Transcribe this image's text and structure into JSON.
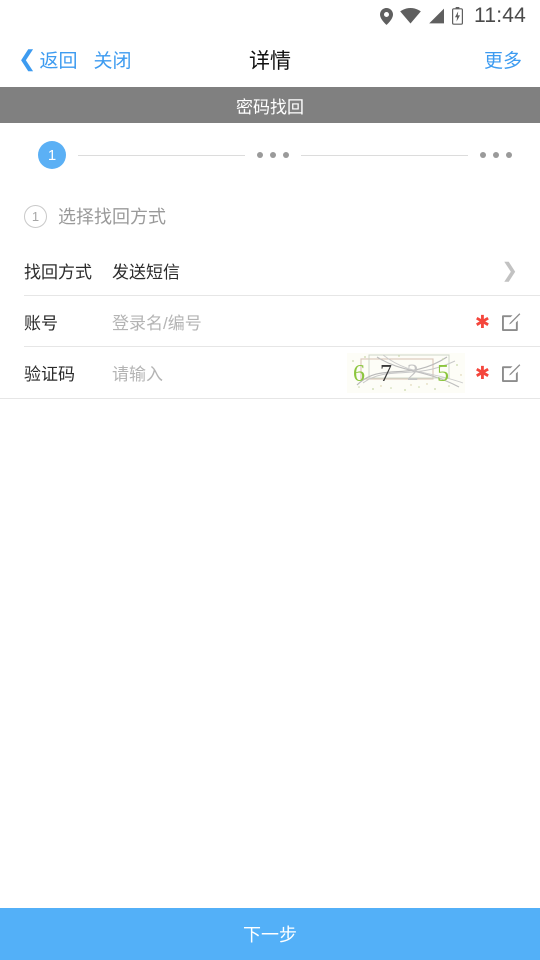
{
  "statusbar": {
    "time": "11:44",
    "icons": [
      "location-pin-icon",
      "wifi-icon",
      "cellular-signal-icon",
      "battery-icon"
    ]
  },
  "navbar": {
    "back_label": "返回",
    "close_label": "关闭",
    "title": "详情",
    "more_label": "更多"
  },
  "subheader": {
    "title": "密码找回"
  },
  "stepper": {
    "current_step": "1",
    "steps_total_indicator": "...",
    "dots": "•••",
    "active_color": "#5bb0f5",
    "line_color": "#dcdcdc"
  },
  "section": {
    "number": "1",
    "label": "选择找回方式"
  },
  "form": {
    "rows": [
      {
        "label": "找回方式",
        "value": "发送短信",
        "accessory": "chevron-right-icon",
        "required": false
      },
      {
        "label": "账号",
        "placeholder": "登录名/编号",
        "value": "",
        "accessory": "edit-icon",
        "required": true
      },
      {
        "label": "验证码",
        "placeholder": "请输入",
        "value": "",
        "accessory": "edit-icon",
        "required": true,
        "captcha_text": "6725"
      }
    ]
  },
  "footer": {
    "next_label": "下一步",
    "button_color": "#53b0f8"
  },
  "colors": {
    "accent_blue": "#3d9bf0",
    "subheader_gray": "#808080",
    "required_red": "#f4463c",
    "placeholder_gray": "#b4b4b4"
  }
}
